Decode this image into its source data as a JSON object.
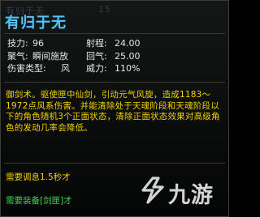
{
  "ghost_header": {
    "label": "有归于无",
    "level": "15"
  },
  "skill": {
    "name": "有归于无",
    "stats": [
      {
        "label": "技力:",
        "value": "96",
        "label2": "射程:",
        "value2": "24.00"
      },
      {
        "label": "聚气:",
        "value": "瞬间施放",
        "label2": "回气:",
        "value2": "25.00"
      },
      {
        "label": "伤害类型:",
        "value": "风",
        "label2": "威力:",
        "value2": "110%"
      }
    ],
    "description": "御剑术。驱使匣中仙剑，引动元气风旋，造成1183～1972点风系伤害。并能清除处于天魂阶段和天魂阶段以下的角色随机3个正面状态，清除正面状态效果对高级角色的发动几率会降低。",
    "cooldown": "需要调息1.5秒才",
    "requirement": "需要装备[剑匣]才"
  },
  "watermark": {
    "text": "九游"
  },
  "colors": {
    "title": "#55c4f2",
    "stat_text": "#e6e6e6",
    "description": "#f2d200",
    "requirement": "#3fd84a"
  }
}
